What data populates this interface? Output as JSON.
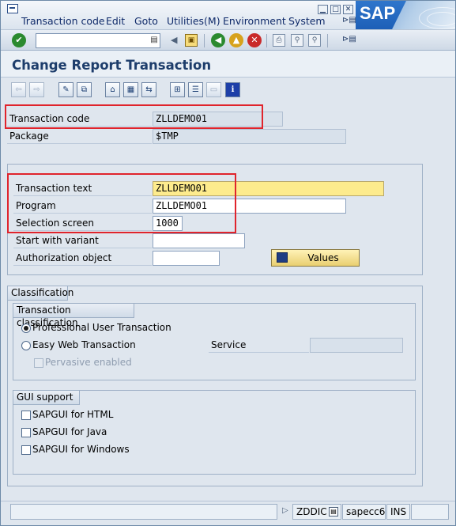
{
  "menu": {
    "items": [
      {
        "label": "Transaction code"
      },
      {
        "label": "Edit"
      },
      {
        "label": "Goto"
      },
      {
        "label": "Utilities(M)"
      },
      {
        "label": "Environment"
      },
      {
        "label": "System"
      }
    ],
    "logo_text": "SAP"
  },
  "toolbar": {
    "command_value": "",
    "icons": [
      "enter-icon",
      "back-icon",
      "save-icon",
      "back-nav-icon",
      "exit-icon",
      "cancel-icon",
      "print-icon",
      "find-icon",
      "find-next-icon",
      "customize-icon"
    ]
  },
  "page": {
    "title": "Change Report Transaction"
  },
  "header_fields": {
    "transaction_code_label": "Transaction code",
    "transaction_code_value": "ZLLDEMO01",
    "package_label": "Package",
    "package_value": "$TMP"
  },
  "details": {
    "transaction_text_label": "Transaction text",
    "transaction_text_value": "ZLLDEMO01",
    "program_label": "Program",
    "program_value": "ZLLDEMO01",
    "selection_screen_label": "Selection screen",
    "selection_screen_value": "1000",
    "start_variant_label": "Start with variant",
    "start_variant_value": "",
    "auth_object_label": "Authorization object",
    "auth_object_value": "",
    "values_button": "Values"
  },
  "classification": {
    "title": "Classification",
    "transaction_classification_title": "Transaction classification",
    "professional_label": "Professional User Transaction",
    "professional_selected": true,
    "easy_web_label": "Easy Web Transaction",
    "service_label": "Service",
    "service_value": "",
    "pervasive_label": "Pervasive enabled",
    "gui_support_title": "GUI support",
    "gui_html_label": "SAPGUI for HTML",
    "gui_java_label": "SAPGUI for Java",
    "gui_windows_label": "SAPGUI for Windows"
  },
  "status": {
    "system": "ZDDIC",
    "server": "sapecc6",
    "mode": "INS"
  },
  "colors": {
    "highlight_box": "#e0242c",
    "required_field": "#fdeb8d",
    "title_text": "#1d3d6b"
  }
}
